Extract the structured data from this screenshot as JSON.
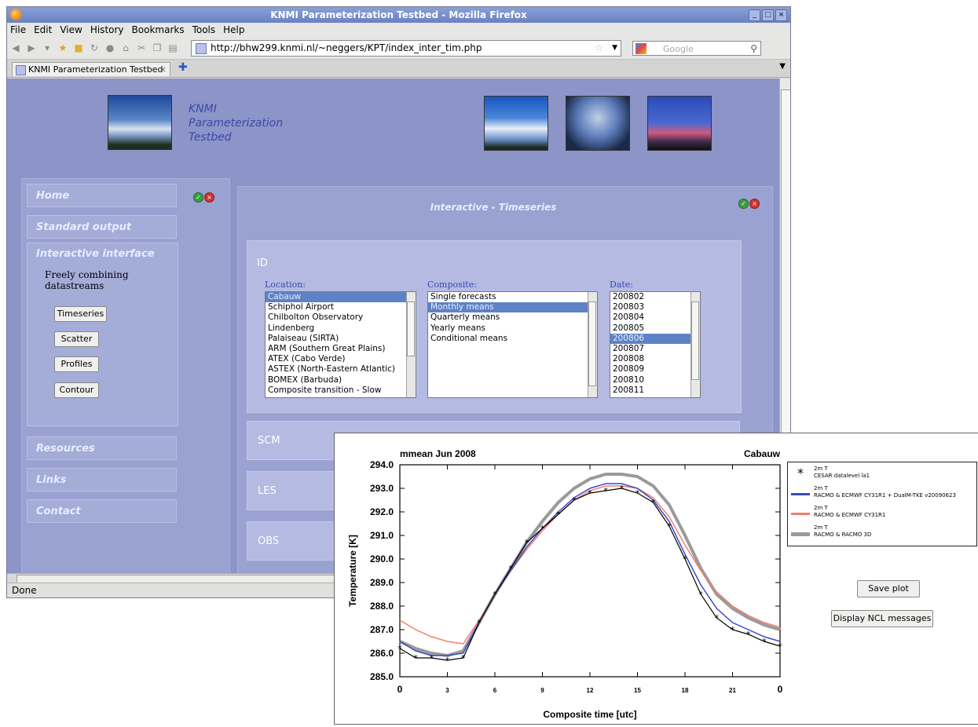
{
  "browser": {
    "window_title": "KNMI Parameterization Testbed - Mozilla Firefox",
    "menu": [
      "File",
      "Edit",
      "View",
      "History",
      "Bookmarks",
      "Tools",
      "Help"
    ],
    "url": "http://bhw299.knmi.nl/~neggers/KPT/index_inter_tim.php",
    "search_placeholder": "Google",
    "tab_title": "KNMI Parameterization Testbed",
    "status": "Done"
  },
  "site": {
    "title_lines": [
      "KNMI",
      "Parameterization",
      "Testbed"
    ],
    "nav": {
      "home": "Home",
      "standard_output": "Standard output",
      "interactive_interface": "Interactive interface",
      "interactive_sub": "Freely combining datastreams",
      "buttons": [
        "Timeseries",
        "Scatter",
        "Profiles",
        "Contour"
      ],
      "resources": "Resources",
      "links": "Links",
      "contact": "Contact"
    },
    "main": {
      "title": "Interactive - Timeseries",
      "id_section": "ID",
      "location_label": "Location:",
      "locations": [
        "Cabauw",
        "Schiphol Airport",
        "Chilbolton Observatory",
        "Lindenberg",
        "Palaiseau (SIRTA)",
        "ARM (Southern Great Plains)",
        "ATEX (Cabo Verde)",
        "ASTEX (North-Eastern Atlantic)",
        "BOMEX (Barbuda)",
        "Composite transition - Slow"
      ],
      "location_selected": 0,
      "composite_label": "Composite:",
      "composites": [
        "Single forecasts",
        "Monthly means",
        "Quarterly means",
        "Yearly means",
        "Conditional means"
      ],
      "composite_selected": 1,
      "date_label": "Date:",
      "dates": [
        "200802",
        "200803",
        "200804",
        "200805",
        "200806",
        "200807",
        "200808",
        "200809",
        "200810",
        "200811"
      ],
      "date_selected": 4,
      "sections": [
        "SCM",
        "LES",
        "OBS"
      ]
    }
  },
  "plot": {
    "save_label": "Save plot",
    "ncl_label": "Display NCL messages"
  },
  "chart_data": {
    "type": "line",
    "title": "mmean  Jun 2008",
    "subtitle": "Cabauw",
    "xlabel": "Composite time  [utc]",
    "ylabel": "Temperature  [K]",
    "xlim": [
      0,
      24
    ],
    "ylim": [
      285.0,
      294.0
    ],
    "xticks": [
      "0",
      "3",
      "6",
      "9",
      "12",
      "15",
      "18",
      "21",
      "0"
    ],
    "yticks": [
      "285.0",
      "286.0",
      "287.0",
      "288.0",
      "289.0",
      "290.0",
      "291.0",
      "292.0",
      "293.0",
      "294.0"
    ],
    "x": [
      0,
      1,
      2,
      3,
      4,
      5,
      6,
      7,
      8,
      9,
      10,
      11,
      12,
      13,
      14,
      15,
      16,
      17,
      18,
      19,
      20,
      21,
      22,
      23,
      24
    ],
    "series": [
      {
        "name": "2m T\nCESAR datalevel la1",
        "color": "#000000",
        "style": "markers",
        "values": [
          286.2,
          285.8,
          285.8,
          285.7,
          285.8,
          287.3,
          288.5,
          289.6,
          290.7,
          291.3,
          291.9,
          292.5,
          292.8,
          292.9,
          293.0,
          292.8,
          292.4,
          291.4,
          290.0,
          288.5,
          287.5,
          287.0,
          286.8,
          286.5,
          286.3
        ]
      },
      {
        "name": "2m T\nRACMO & ECMWF CY31R1 + DualM-TKE v20090623",
        "color": "#3a4ac8",
        "style": "line",
        "values": [
          286.5,
          286.1,
          285.9,
          285.9,
          286.0,
          287.3,
          288.5,
          289.5,
          290.5,
          291.3,
          292.0,
          292.6,
          293.0,
          293.2,
          293.2,
          293.0,
          292.5,
          291.6,
          290.2,
          288.9,
          287.9,
          287.3,
          287.0,
          286.7,
          286.5
        ]
      },
      {
        "name": "2m T\nRACMO & ECMWF CY31R1",
        "color": "#f08070",
        "style": "line",
        "values": [
          287.4,
          287.0,
          286.7,
          286.5,
          286.4,
          287.4,
          288.5,
          289.5,
          290.4,
          291.2,
          291.9,
          292.5,
          292.9,
          293.1,
          293.1,
          293.0,
          292.6,
          291.8,
          290.6,
          289.5,
          288.6,
          288.0,
          287.6,
          287.3,
          287.1
        ]
      },
      {
        "name": "2m T\nRACMO & RACMO 3D",
        "color": "#9a9a9a",
        "style": "thick",
        "values": [
          286.5,
          286.2,
          286.0,
          285.9,
          286.1,
          287.3,
          288.5,
          289.6,
          290.7,
          291.6,
          292.4,
          293.0,
          293.4,
          293.6,
          293.6,
          293.5,
          293.1,
          292.3,
          291.0,
          289.6,
          288.5,
          287.9,
          287.5,
          287.2,
          287.0
        ]
      }
    ],
    "grid": false,
    "legend": "top-right"
  }
}
